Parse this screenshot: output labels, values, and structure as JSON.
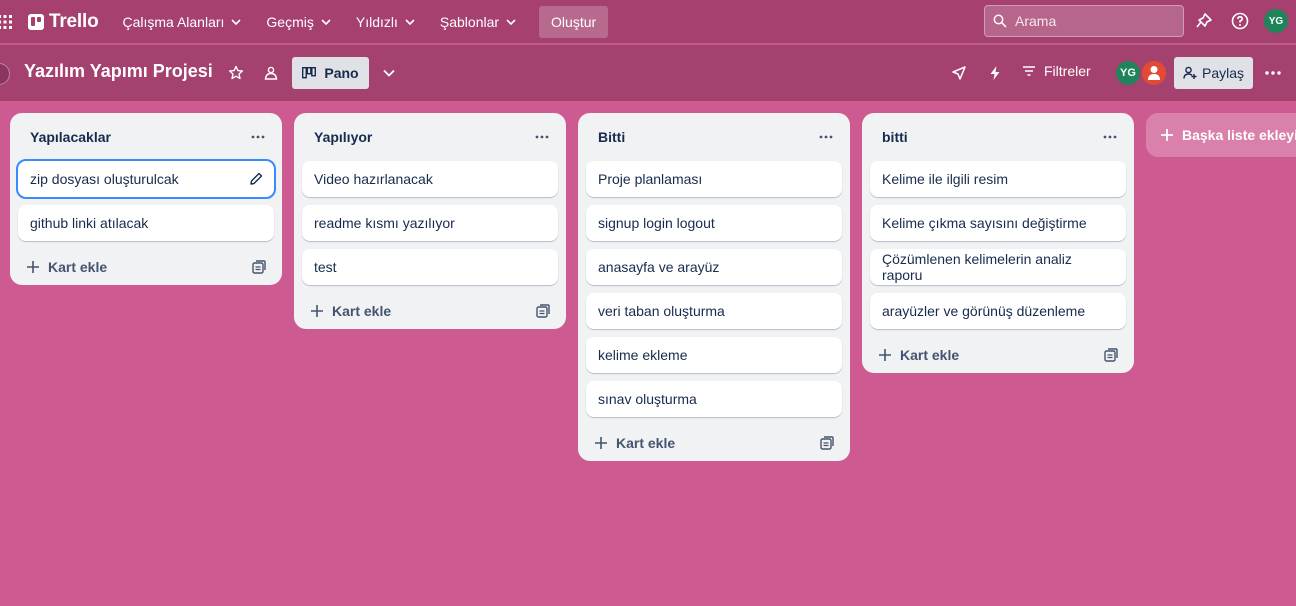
{
  "topnav": {
    "logo_text": "Trello",
    "items": [
      {
        "label": "Çalışma Alanları"
      },
      {
        "label": "Geçmiş"
      },
      {
        "label": "Yıldızlı"
      },
      {
        "label": "Şablonlar"
      }
    ],
    "create_label": "Oluştur",
    "search_placeholder": "Arama",
    "avatar_initials": "YG"
  },
  "board": {
    "title": "Yazılım Yapımı Projesi",
    "view_label": "Pano",
    "filter_label": "Filtreler",
    "member_initials": "YG",
    "share_label": "Paylaş"
  },
  "lists": [
    {
      "title": "Yapılacaklar",
      "cards": [
        "zip dosyası oluşturulcak",
        "github linki atılacak"
      ],
      "add_label": "Kart ekle"
    },
    {
      "title": "Yapılıyor",
      "cards": [
        "Video hazırlanacak",
        "readme kısmı yazılıyor",
        "test"
      ],
      "add_label": "Kart ekle"
    },
    {
      "title": "Bitti",
      "cards": [
        "Proje planlaması",
        "signup login logout",
        "anasayfa ve arayüz",
        "veri taban oluşturma",
        "kelime ekleme",
        "sınav oluşturma"
      ],
      "add_label": "Kart ekle"
    },
    {
      "title": "bitti",
      "cards": [
        "Kelime ile ilgili resim",
        "Kelime çıkma sayısını değiştirme",
        "Çözümlenen kelimelerin analiz raporu",
        "arayüzler ve görünüş düzenleme"
      ],
      "add_label": "Kart ekle"
    }
  ],
  "add_list_label": "Başka liste ekleyin",
  "colors": {
    "background": "#cd5a91",
    "header": "#a5406f",
    "avatar": "#1f845a",
    "focus": "#388bff"
  }
}
